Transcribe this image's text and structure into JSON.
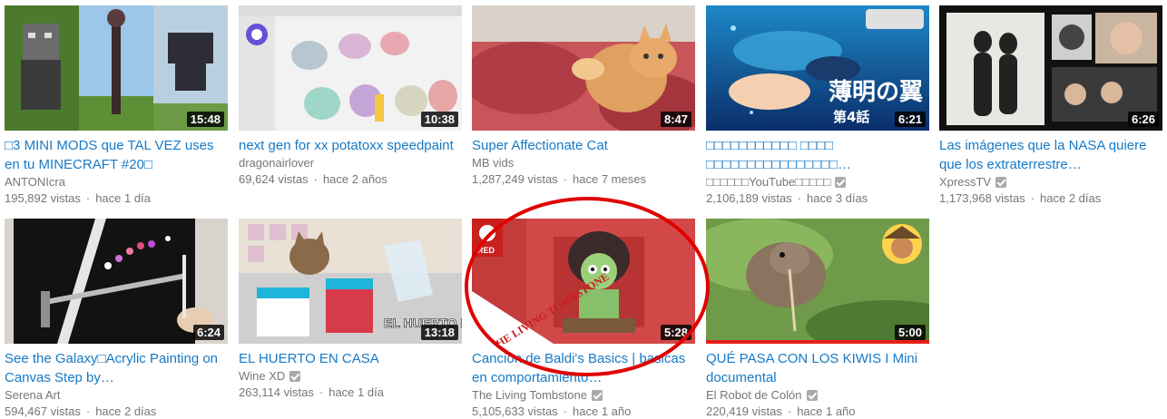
{
  "videos": [
    {
      "title": "□3 MINI MODS que TAL VEZ uses en tu MINECRAFT #20□",
      "channel": "ANTONIcra",
      "verified": false,
      "views": "195,892 vistas",
      "age": "hace 1 día",
      "duration": "15:48"
    },
    {
      "title": "next gen for xx potatoxx speedpaint",
      "channel": "dragonairlover",
      "verified": false,
      "views": "69,624 vistas",
      "age": "hace 2 años",
      "duration": "10:38"
    },
    {
      "title": "Super Affectionate Cat",
      "channel": "MB vids",
      "verified": false,
      "views": "1,287,249 vistas",
      "age": "hace 7 meses",
      "duration": "8:47"
    },
    {
      "title": "□□□□□□□□□□□ □□□□ □□□□□□□□□□□□□□□□…",
      "channel": "□□□□□□YouTube□□□□□",
      "verified": true,
      "views": "2,106,189 vistas",
      "age": "hace 3 días",
      "duration": "6:21",
      "thumb_text": "薄明の翼",
      "thumb_episode": "第4話"
    },
    {
      "title": "Las imágenes que la NASA quiere que los extraterrestre…",
      "channel": "XpressTV",
      "verified": true,
      "views": "1,173,968 vistas",
      "age": "hace 2 días",
      "duration": "6:26"
    },
    {
      "title": "See the Galaxy□Acrylic Painting on Canvas Step by…",
      "channel": "Serena Art",
      "verified": false,
      "views": "594,467 vistas",
      "age": "hace 2 días",
      "duration": "6:24"
    },
    {
      "title": "EL HUERTO EN CASA",
      "channel": "Wine XD",
      "verified": true,
      "views": "263,114 vistas",
      "age": "hace 1 día",
      "duration": "13:18",
      "thumb_text": "EL HUERTO EN C"
    },
    {
      "title": "Canción de Baldi's Basics | basicas en comportamiento…",
      "channel": "The Living Tombstone",
      "verified": true,
      "views": "5,105,633 vistas",
      "age": "hace 1 año",
      "duration": "5:28",
      "thumb_text": "THE LIVING TOMBSTONE",
      "thumb_badge": "RED"
    },
    {
      "title": "QUÉ PASA CON LOS KIWIS I Mini documental",
      "channel": "El Robot de Colón",
      "verified": true,
      "views": "220,419 vistas",
      "age": "hace 1 año",
      "duration": "5:00",
      "watched": 1.0
    }
  ],
  "colors": {
    "link": "#167ac6",
    "meta": "#767676",
    "annotation": "#e00000",
    "watchbar": "#e62117"
  }
}
